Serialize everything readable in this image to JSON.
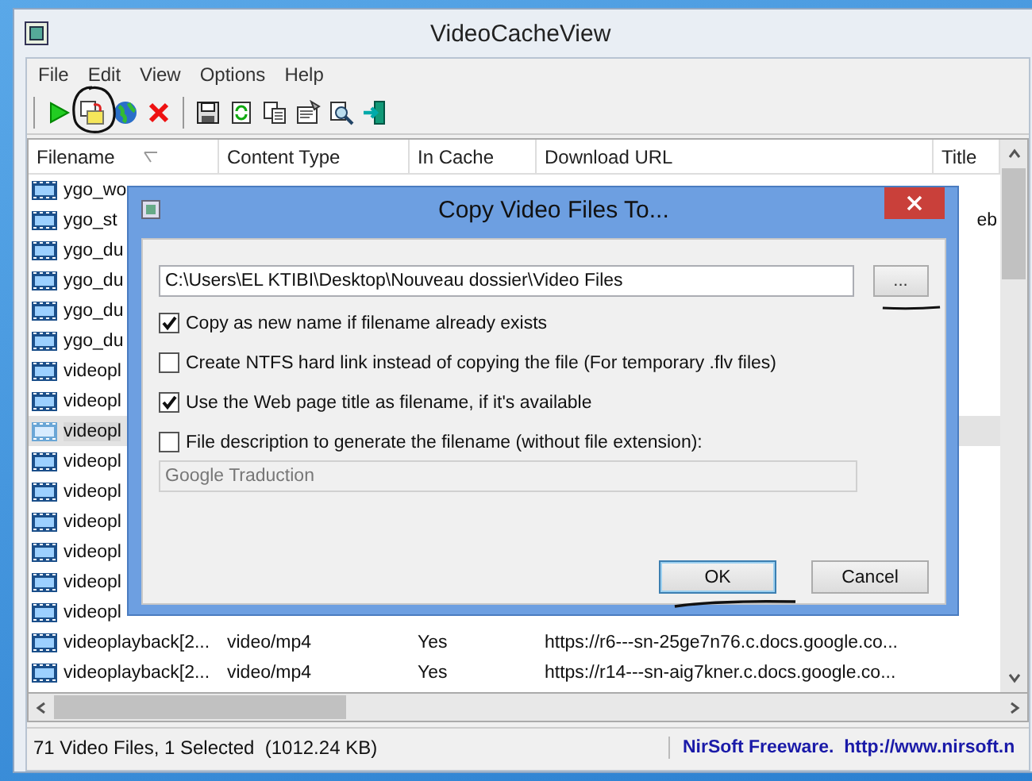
{
  "window": {
    "title": "VideoCacheView"
  },
  "menu": [
    "File",
    "Edit",
    "View",
    "Options",
    "Help"
  ],
  "columns": [
    {
      "label": "Filename",
      "sorted": true
    },
    {
      "label": "Content Type",
      "sorted": false
    },
    {
      "label": "In Cache",
      "sorted": false
    },
    {
      "label": "Download URL",
      "sorted": false
    },
    {
      "label": "Title",
      "sorted": false
    }
  ],
  "rows": [
    {
      "filename": "ygo_wo",
      "selected": false
    },
    {
      "filename": "ygo_st",
      "title": "eb",
      "selected": false
    },
    {
      "filename": "ygo_du",
      "selected": false
    },
    {
      "filename": "ygo_du",
      "selected": false
    },
    {
      "filename": "ygo_du",
      "selected": false
    },
    {
      "filename": "ygo_du",
      "selected": false
    },
    {
      "filename": "videopl",
      "selected": false
    },
    {
      "filename": "videopl",
      "selected": false
    },
    {
      "filename": "videopl",
      "selected": true
    },
    {
      "filename": "videopl",
      "selected": false
    },
    {
      "filename": "videopl",
      "selected": false
    },
    {
      "filename": "videopl",
      "selected": false
    },
    {
      "filename": "videopl",
      "selected": false
    },
    {
      "filename": "videopl",
      "selected": false
    },
    {
      "filename": "videopl",
      "selected": false
    },
    {
      "filename": "videoplayback[2...",
      "content_type": "video/mp4",
      "in_cache": "Yes",
      "url": "https://r6---sn-25ge7n76.c.docs.google.co...",
      "selected": false
    },
    {
      "filename": "videoplayback[2...",
      "content_type": "video/mp4",
      "in_cache": "Yes",
      "url": "https://r14---sn-aig7kner.c.docs.google.co...",
      "selected": false
    }
  ],
  "dialog": {
    "title": "Copy Video Files To...",
    "path": "C:\\Users\\EL KTIBI\\Desktop\\Nouveau dossier\\Video Files",
    "browse_label": "...",
    "options": [
      {
        "label": "Copy as new name if filename already exists",
        "checked": true
      },
      {
        "label": "Create NTFS hard link instead of copying the file (For temporary .flv files)",
        "checked": false
      },
      {
        "label": "Use the Web page title as filename, if it's available",
        "checked": true
      },
      {
        "label": "File description to generate the filename (without file extension):",
        "checked": false
      }
    ],
    "description_field": {
      "value": "Google Traduction",
      "disabled": true
    },
    "buttons": [
      {
        "label": "OK",
        "default": true
      },
      {
        "label": "Cancel",
        "default": false
      }
    ]
  },
  "status_bar": {
    "summary": "71 Video Files, 1 Selected  (1012.24 KB)",
    "link": "NirSoft Freeware.  http://www.nirsoft.n"
  }
}
